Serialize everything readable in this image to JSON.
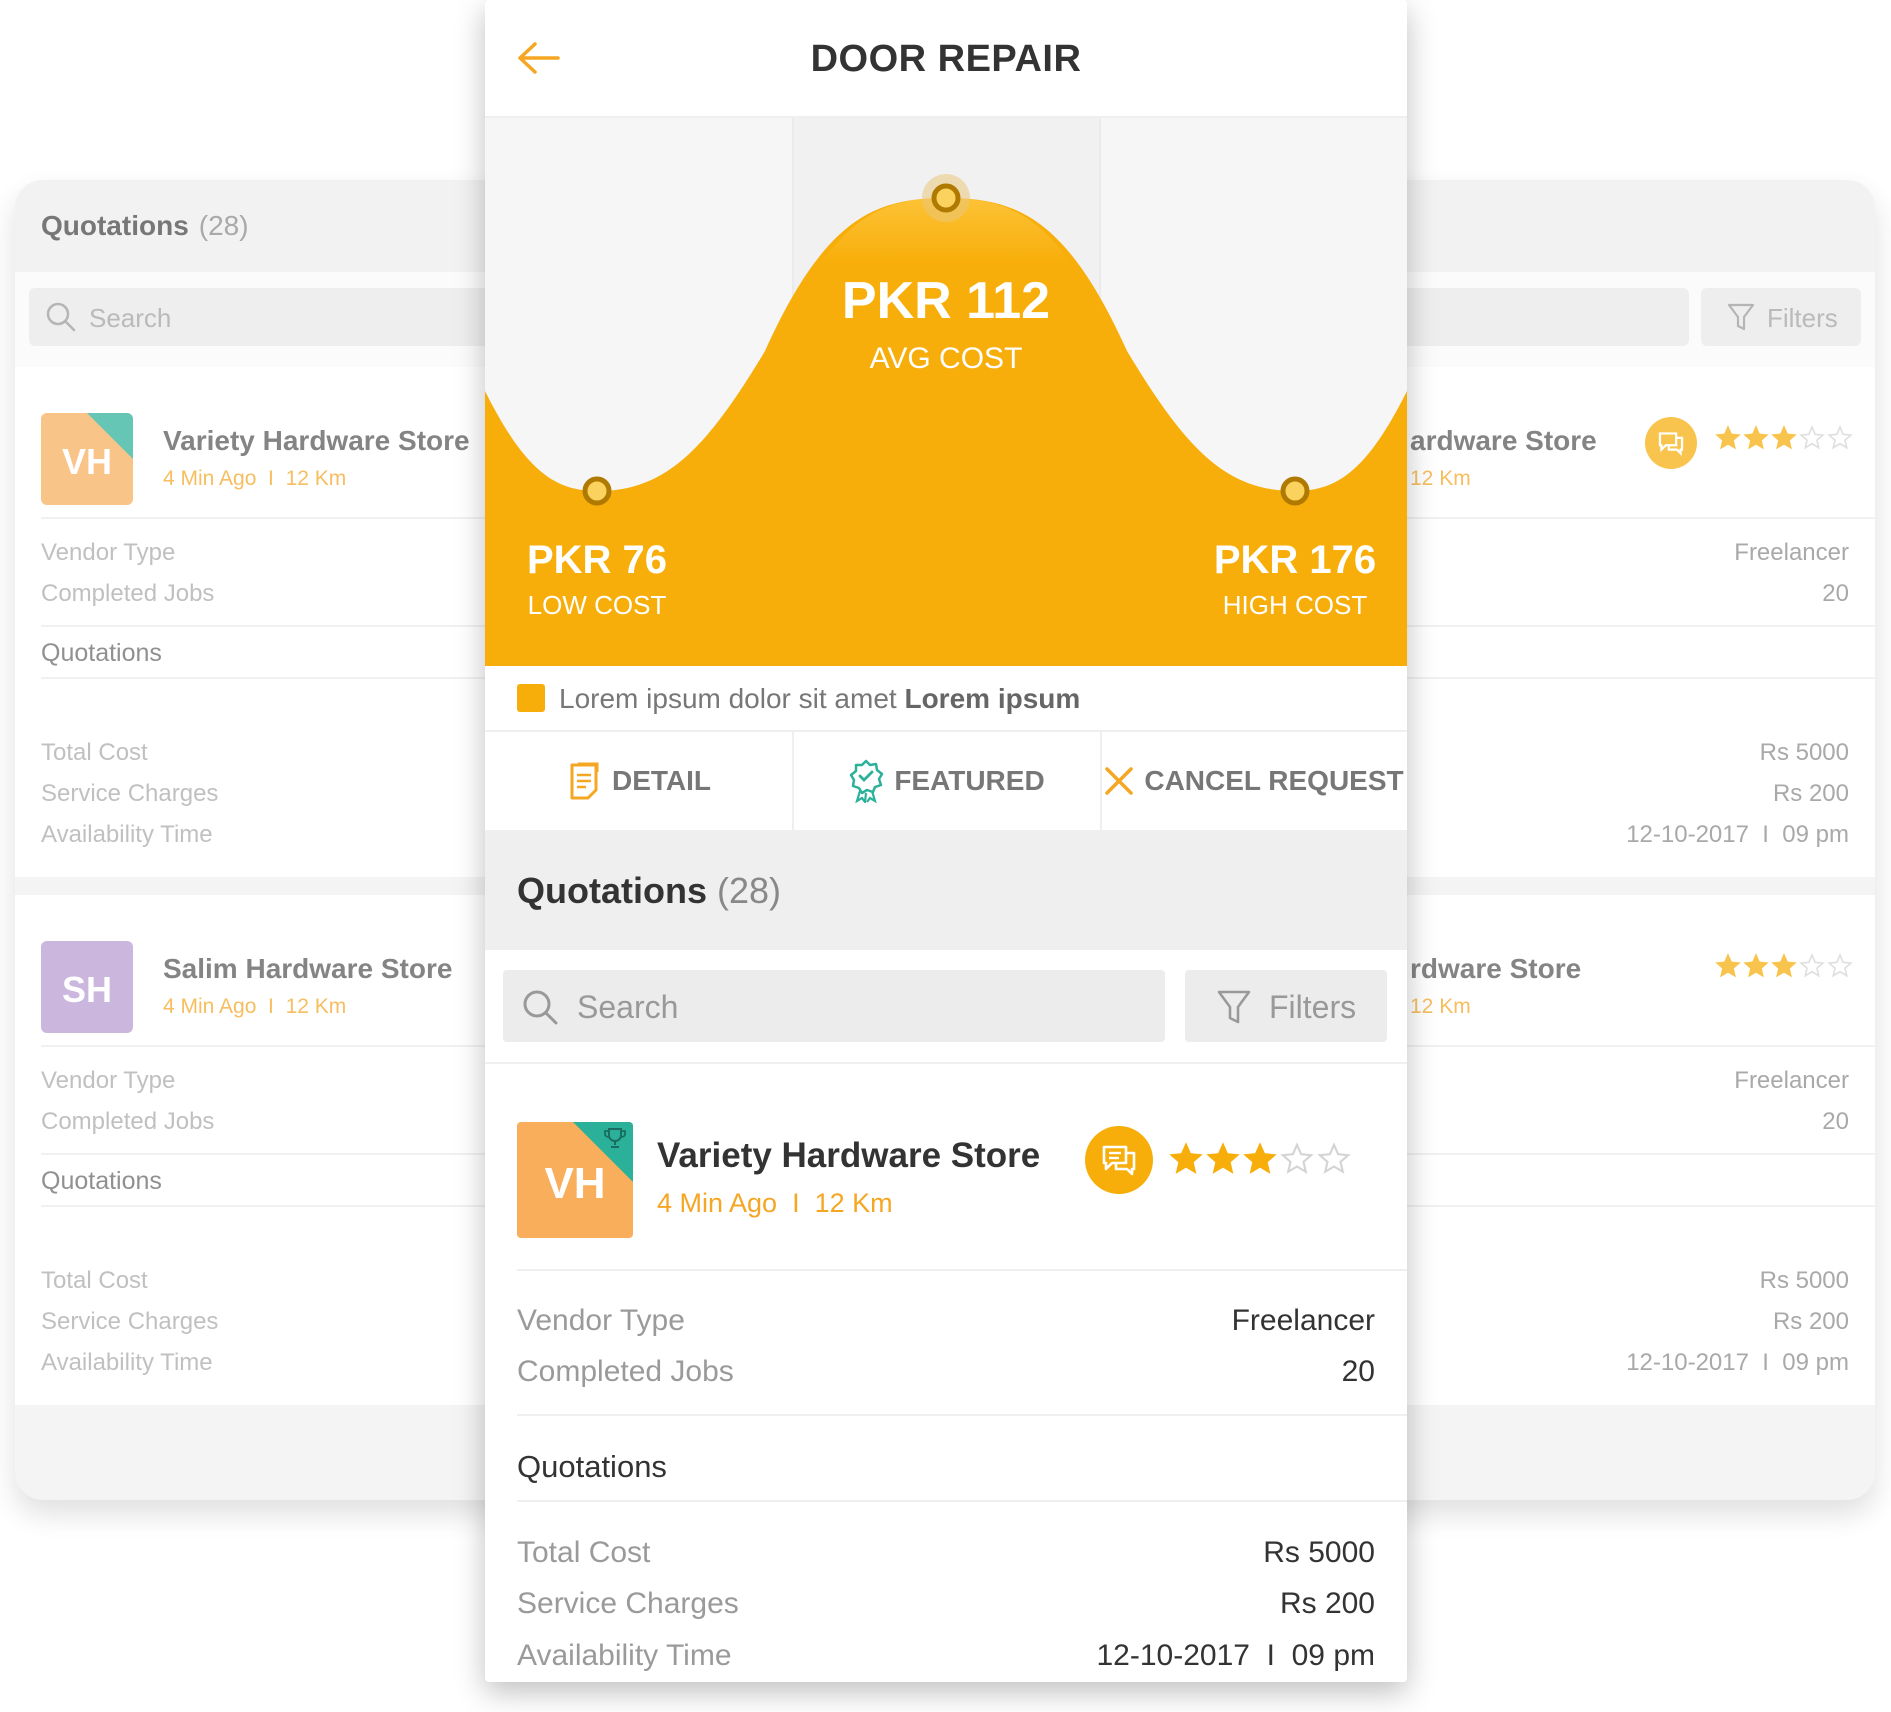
{
  "page": {
    "title": "DOOR REPAIR"
  },
  "chart_data": {
    "type": "area",
    "points": [
      {
        "label": "LOW COST",
        "value_text": "PKR 76",
        "value": 76
      },
      {
        "label": "AVG COST",
        "value_text": "PKR 112",
        "value": 112
      },
      {
        "label": "HIGH COST",
        "value_text": "PKR 176",
        "value": 176
      }
    ],
    "fill_color": "#f8ae0a",
    "marker_color": "#b07a00"
  },
  "legend": {
    "text": "Lorem ipsum dolor sit amet",
    "bold": "Lorem ipsum",
    "color": "#f8ae0a"
  },
  "actions": {
    "detail": "DETAIL",
    "featured": "FEATURED",
    "cancel": "CANCEL REQUEST"
  },
  "quotations": {
    "title": "Quotations",
    "count": "(28)"
  },
  "search": {
    "placeholder": "Search",
    "filters": "Filters"
  },
  "labels": {
    "vendor_type": "Vendor Type",
    "completed_jobs": "Completed Jobs",
    "quotations": "Quotations",
    "total_cost": "Total Cost",
    "service_charges": "Service Charges",
    "availability_time": "Availability Time"
  },
  "vendor": {
    "initials": "VH",
    "name": "Variety Hardware Store",
    "meta": "4 Min Ago  I  12 Km",
    "rating": 3,
    "rating_max": 5,
    "vendor_type": "Freelancer",
    "completed_jobs": "20",
    "total_cost": "Rs 5000",
    "service_charges": "Rs 200",
    "availability_time": "12-10-2017  I  09 pm"
  },
  "background_list": [
    {
      "initials": "VH",
      "avatar_color": "#f8ae5b",
      "badge": true,
      "name": "Variety Hardware Store",
      "name_right": "ardware Store",
      "meta": "4 Min Ago  I  12 Km",
      "meta_right": "12 Km",
      "chat": true,
      "rating": 3,
      "vendor_type": "Freelancer",
      "completed_jobs": "20",
      "total_cost": "Rs 5000",
      "service_charges": "Rs 200",
      "availability_time": "12-10-2017  I  09 pm"
    },
    {
      "initials": "SH",
      "avatar_color": "#b89ad0",
      "badge": false,
      "name": "Salim Hardware Store",
      "name_right": "rdware Store",
      "meta": "4 Min Ago  I  12 Km",
      "meta_right": "12 Km",
      "chat": false,
      "rating": 3,
      "vendor_type": "Freelancer",
      "completed_jobs": "20",
      "total_cost": "Rs 5000",
      "service_charges": "Rs 200",
      "availability_time": "12-10-2017  I  09 pm"
    }
  ]
}
